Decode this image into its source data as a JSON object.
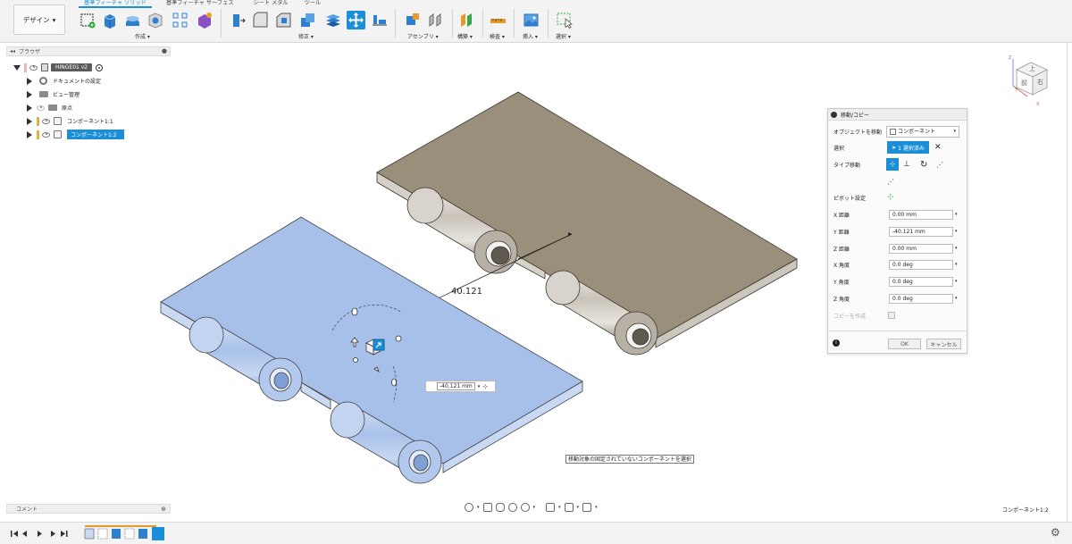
{
  "toolbar": {
    "design_label": "デザイン",
    "tabs": [
      "基準フィーチャ ソリッド",
      "基準フィーチャ サーフェス",
      "シート メタル",
      "ツール"
    ],
    "groups": {
      "create": "作成",
      "modify": "修正",
      "assemble": "アセンブリ",
      "construct": "構築",
      "inspect": "検査",
      "insert": "挿入",
      "select": "選択"
    }
  },
  "browser": {
    "title": "ブラウザ",
    "root": "HINGE01 v2",
    "items": [
      {
        "label": "ドキュメントの設定"
      },
      {
        "label": "ビュー管理"
      },
      {
        "label": "原点"
      },
      {
        "label": "コンポーネント1:1"
      },
      {
        "label": "コンポーネント1:2"
      }
    ]
  },
  "viewport": {
    "dimension_label": "40.121",
    "dimension_input": "-40.121 mm",
    "hint": "移動対象の固定されていないコンポーネントを選択",
    "status_component": "コンポーネント1:2"
  },
  "viewcube": {
    "top": "上",
    "front": "前",
    "right": "右",
    "x_axis": "X",
    "y_axis": "Y",
    "z_axis": "Z"
  },
  "move_panel": {
    "title": "移動/コピー",
    "move_object_label": "オブジェクトを移動",
    "move_object_value": "コンポーネント",
    "selection_label": "選択",
    "selection_value": "1 選択済み",
    "type_label": "タイプ移動",
    "pivot_label": "ピボット設定",
    "fields": [
      {
        "label": "X 距離",
        "value": "0.00 mm"
      },
      {
        "label": "Y 距離",
        "value": "-40.121 mm"
      },
      {
        "label": "Z 距離",
        "value": "0.00 mm"
      },
      {
        "label": "X 角度",
        "value": "0.0 deg"
      },
      {
        "label": "Y 角度",
        "value": "0.0 deg"
      },
      {
        "label": "Z 角度",
        "value": "0.0 deg"
      }
    ],
    "copy_label": "コピーを作成",
    "ok_label": "OK",
    "cancel_label": "キャンセル"
  },
  "bottom": {
    "comment_label": "コメント"
  },
  "colors": {
    "accent": "#1a8fd8",
    "brown_part": "#9a8f7b",
    "blue_part": "#a7c0ea"
  }
}
